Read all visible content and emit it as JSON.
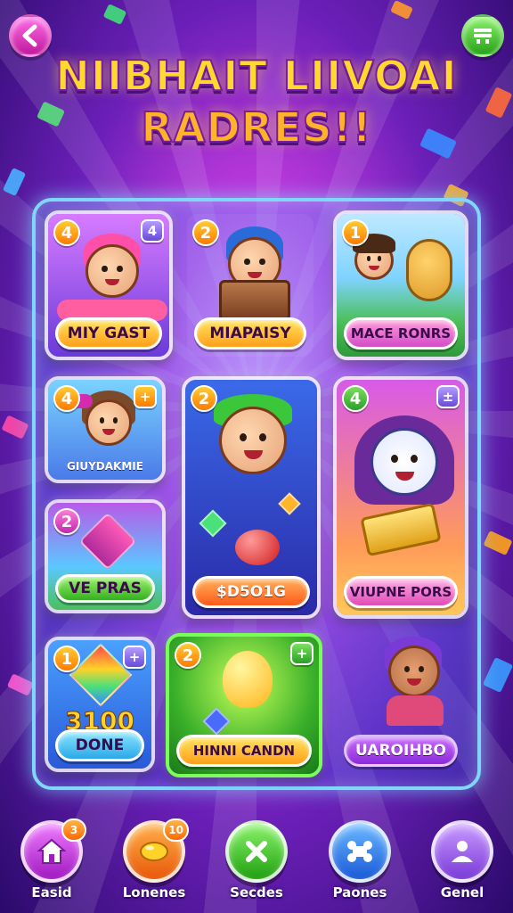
{
  "header": {
    "title_line1": "NIIBHAIT LIIVOAI",
    "title_line2": "RADRES!!"
  },
  "cards": [
    {
      "label": "MIY GAST",
      "badge_left": "4",
      "badge_right": "4"
    },
    {
      "label": "MIAPAISY",
      "badge_left": "2",
      "badge_right": ""
    },
    {
      "label": "MACE RONRS",
      "badge_left": "1",
      "badge_right": ""
    },
    {
      "label": "GIUYDAKMIE",
      "badge_left": "4",
      "badge_right": "+"
    },
    {
      "label": "$D5O1G",
      "badge_left": "2",
      "badge_right": ""
    },
    {
      "label": "VIUPNE PORS",
      "badge_left": "4",
      "badge_right": "±"
    },
    {
      "label": "VE PRAS",
      "badge_left": "2",
      "badge_right": ""
    },
    {
      "label": "DONE",
      "badge_left": "1",
      "badge_right": "+",
      "value": "3100"
    },
    {
      "label": "HINNI CANDN",
      "badge_left": "2",
      "badge_right": "+"
    },
    {
      "label": "UAROIHBO",
      "badge_left": "",
      "badge_right": ""
    }
  ],
  "nav": [
    {
      "label": "Easid",
      "badge": "3",
      "icon": "house-icon",
      "color": "#c23bd9"
    },
    {
      "label": "Lonenes",
      "badge": "10",
      "icon": "candy-icon",
      "color": "#ff7a1a"
    },
    {
      "label": "Secdes",
      "badge": "",
      "icon": "close-icon",
      "color": "#34c020"
    },
    {
      "label": "Paones",
      "badge": "",
      "icon": "bone-icon",
      "color": "#2f7ae8"
    },
    {
      "label": "Genel",
      "badge": "",
      "icon": "person-icon",
      "color": "#8f4ad9"
    }
  ]
}
